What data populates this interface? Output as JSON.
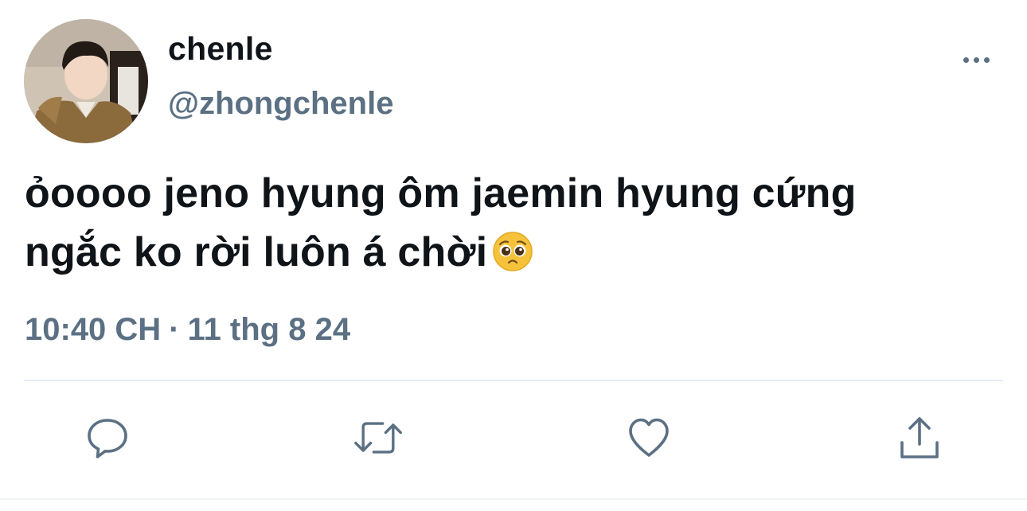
{
  "author": {
    "display_name": "chenle",
    "handle": "@zhongchenle",
    "avatar_icon": "profile-photo"
  },
  "tweet": {
    "text_line1": "ỏoooo jeno hyung ôm jaemin hyung cứng",
    "text_line2": "ngắc ko rời luôn á chời",
    "emoji": "pleading-face"
  },
  "meta": {
    "time": "10:40 CH",
    "separator": "·",
    "date": "11 thg 8 24"
  },
  "actions": {
    "reply_icon": "reply-icon",
    "retweet_icon": "retweet-icon",
    "like_icon": "heart-icon",
    "share_icon": "share-icon"
  },
  "colors": {
    "primary_text": "#0f1419",
    "secondary_text": "#5b7083",
    "divider": "#e6ecf0"
  }
}
